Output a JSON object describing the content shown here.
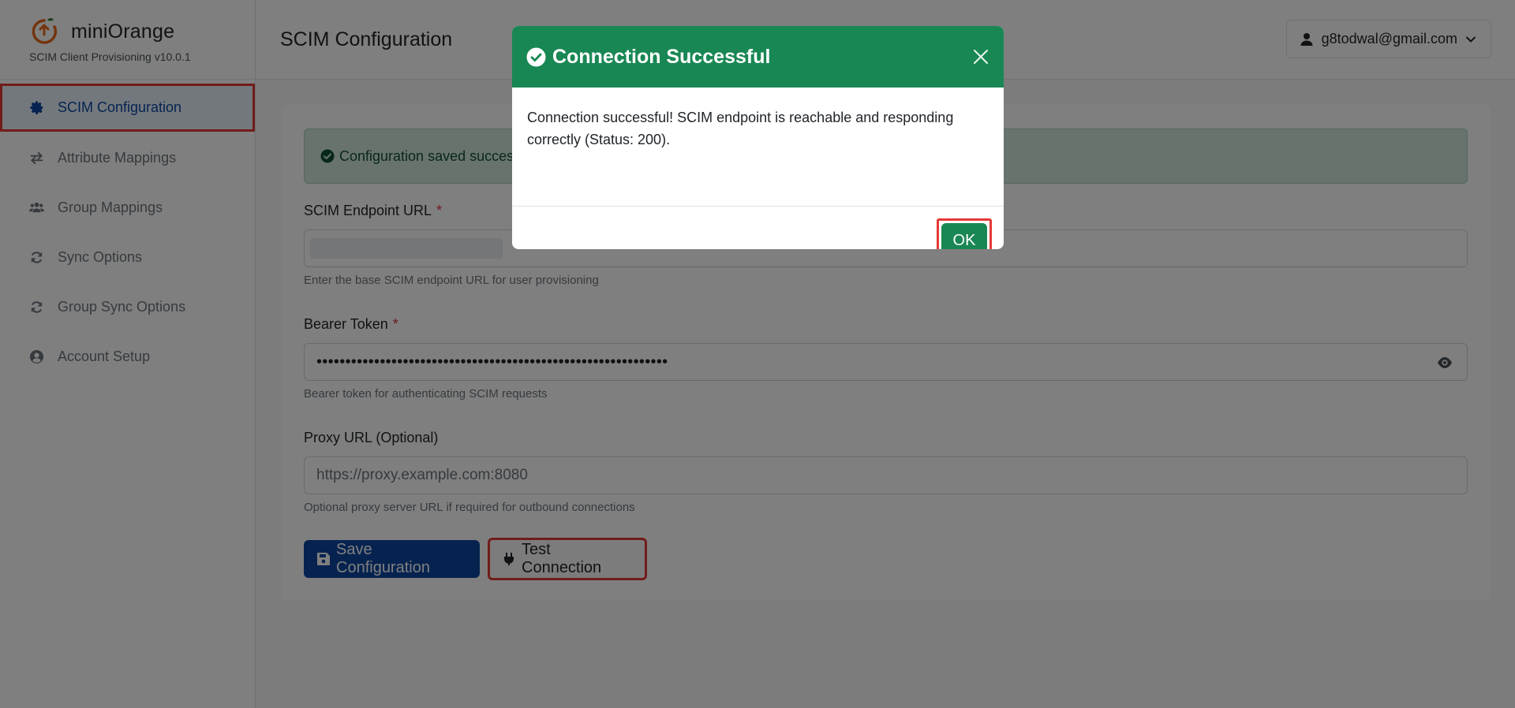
{
  "brand": {
    "name": "miniOrange",
    "subtitle": "SCIM Client Provisioning v10.0.1"
  },
  "sidebar": {
    "items": [
      {
        "label": "SCIM Configuration",
        "icon": "gear-icon",
        "active": true
      },
      {
        "label": "Attribute Mappings",
        "icon": "arrows-exchange-icon"
      },
      {
        "label": "Group Mappings",
        "icon": "users-icon"
      },
      {
        "label": "Sync Options",
        "icon": "sync-icon"
      },
      {
        "label": "Group Sync Options",
        "icon": "sync-icon"
      },
      {
        "label": "Account Setup",
        "icon": "user-circle-icon"
      }
    ]
  },
  "header": {
    "title": "SCIM Configuration",
    "user": "g8todwal@gmail.com"
  },
  "alert": {
    "text": "Configuration saved successfully"
  },
  "form": {
    "endpoint": {
      "label": "SCIM Endpoint URL",
      "required": "*",
      "help": "Enter the base SCIM endpoint URL for user provisioning"
    },
    "token": {
      "label": "Bearer Token",
      "required": "*",
      "value": "•••••••••••••••••••••••••••••••••••••••••••••••••••••••••••••",
      "help": "Bearer token for authenticating SCIM requests"
    },
    "proxy": {
      "label": "Proxy URL (Optional)",
      "placeholder": "https://proxy.example.com:8080",
      "help": "Optional proxy server URL if required for outbound connections"
    },
    "save_label": "Save Configuration",
    "test_label": "Test Connection"
  },
  "modal": {
    "title": "Connection Successful",
    "body": "Connection successful! SCIM endpoint is reachable and responding correctly (Status: 200).",
    "ok_label": "OK"
  },
  "colors": {
    "success": "#198754",
    "primary": "#0d47a1",
    "highlight": "#e53935"
  }
}
